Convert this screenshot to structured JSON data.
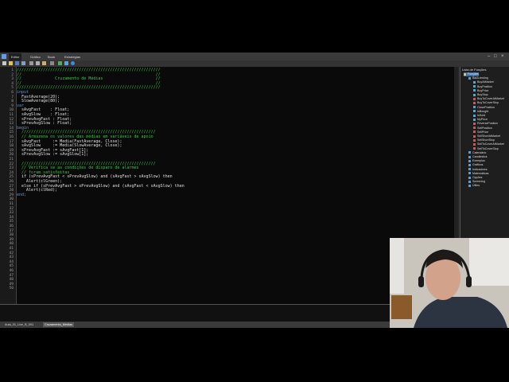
{
  "tabs": [
    {
      "label": "Editor",
      "active": true
    },
    {
      "label": "Gráfico",
      "active": false
    },
    {
      "label": "Book",
      "active": false
    },
    {
      "label": "Estratégias",
      "active": false
    }
  ],
  "window_controls": [
    "–",
    "□",
    "×"
  ],
  "gutter_numbers": [
    "1",
    "2",
    "3",
    "4",
    "5",
    "6",
    "7",
    "8",
    "9",
    "10",
    "11",
    "12",
    "13",
    "14",
    "15",
    "16",
    "17",
    "18",
    "19",
    "20",
    "21",
    "22",
    "23",
    "24",
    "25",
    "26",
    "27",
    "28",
    "29",
    "30",
    "31",
    "32",
    "33",
    "34",
    "35",
    "36",
    "37",
    "38",
    "39",
    "40",
    "41",
    "42",
    "43",
    "44",
    "45",
    "46",
    "47",
    "48",
    "49",
    "50"
  ],
  "code_lines": [
    {
      "t": "////////////////////////////////////////////////////////////",
      "c": "#2ecc40"
    },
    {
      "t": "//                                                        //",
      "c": "#2ecc40"
    },
    {
      "t": "//              Cruzamento de Médias                      //",
      "c": "#2ecc40"
    },
    {
      "t": "//                                                        //",
      "c": "#2ecc40"
    },
    {
      "t": "////////////////////////////////////////////////////////////",
      "c": "#2ecc40"
    },
    {
      "t": "input",
      "c": "#5b9bd5"
    },
    {
      "t": "  FastAverage(20);",
      "c": "#e0e0e0"
    },
    {
      "t": "  SlowAverage(80);",
      "c": "#e0e0e0"
    },
    {
      "t": "var",
      "c": "#5b9bd5"
    },
    {
      "t": "  sAvgFast    : Float;",
      "c": "#e0e0e0"
    },
    {
      "t": "  sAvgSlow    : Float;",
      "c": "#e0e0e0"
    },
    {
      "t": "  sPrevAvgFast : Float;",
      "c": "#e0e0e0"
    },
    {
      "t": "  sPrevAvgSlow : Float;",
      "c": "#e0e0e0"
    },
    {
      "t": "begin",
      "c": "#5b9bd5"
    },
    {
      "t": "  ////////////////////////////////////////////////////////",
      "c": "#2ecc40"
    },
    {
      "t": "  // Armazena os valores das médias em variáveis de apoio",
      "c": "#2ecc40"
    },
    {
      "t": "  sAvgFast     := Media(FastAverage, Close);",
      "c": "#e0e0e0"
    },
    {
      "t": "  sAvgSlow     := Media(SlowAverage, Close);",
      "c": "#e0e0e0"
    },
    {
      "t": "  sPrevAvgFast := sAvgFast[1];",
      "c": "#e0e0e0"
    },
    {
      "t": "  sPrevAvgSlow := sAvgSlow[1];",
      "c": "#e0e0e0"
    },
    {
      "t": "",
      "c": "#e0e0e0"
    },
    {
      "t": "  ////////////////////////////////////////////////////////",
      "c": "#2ecc40"
    },
    {
      "t": "  // Verifica se as condições de disparo de alarmes",
      "c": "#2ecc40"
    },
    {
      "t": "  // foram satisfeitas",
      "c": "#2ecc40"
    },
    {
      "t": "  if (sPrevAvgFast < sPrevAvgSlow) and (sAvgFast > sAvgSlow) then",
      "c": "#e0e0e0"
    },
    {
      "t": "    Alert(clGreen);",
      "c": "#e0e0e0"
    },
    {
      "t": "  else if (sPrevAvgFast > sPrevAvgSlow) and (sAvgFast < sAvgSlow) then",
      "c": "#e0e0e0"
    },
    {
      "t": "    Alert(clRed);",
      "c": "#e0e0e0"
    },
    {
      "t": "end;",
      "c": "#5b9bd5"
    }
  ],
  "documents": [
    {
      "label": "Aula_01_Live_B_001",
      "active": false
    },
    {
      "label": "Cruzamento_Medias",
      "active": true
    }
  ],
  "panel": {
    "title": "Lista de Funções",
    "items": [
      {
        "label": "Funções",
        "level": 0,
        "color": "#e8c04a",
        "sel": true
      },
      {
        "label": "Back-testing",
        "level": 1,
        "color": "#4aa3e8",
        "sel": false
      },
      {
        "label": "BuyAtMarket",
        "level": 2,
        "color": "#3cb0e8",
        "sel": false
      },
      {
        "label": "BuyPosition",
        "level": 2,
        "color": "#3cb0e8",
        "sel": false
      },
      {
        "label": "BuyPrice",
        "level": 2,
        "color": "#3cb0e8",
        "sel": false
      },
      {
        "label": "BuyStop",
        "level": 2,
        "color": "#3cb0e8",
        "sel": false
      },
      {
        "label": "BuyToCoverAtMarket",
        "level": 2,
        "color": "#e05050",
        "sel": false
      },
      {
        "label": "BuyToCoverStop",
        "level": 2,
        "color": "#e05050",
        "sel": false
      },
      {
        "label": "ClosePosition",
        "level": 2,
        "color": "#3cb0e8",
        "sel": false
      },
      {
        "label": "IsBought",
        "level": 2,
        "color": "#3cb0e8",
        "sel": false
      },
      {
        "label": "IsSold",
        "level": 2,
        "color": "#3cb0e8",
        "sel": false
      },
      {
        "label": "MyPrice",
        "level": 2,
        "color": "#3cb0e8",
        "sel": false
      },
      {
        "label": "ReversePosition",
        "level": 2,
        "color": "#e05050",
        "sel": false
      },
      {
        "label": "SellPosition",
        "level": 2,
        "color": "#e05050",
        "sel": false
      },
      {
        "label": "SellPrice",
        "level": 2,
        "color": "#e05050",
        "sel": false
      },
      {
        "label": "SellShortAtMarket",
        "level": 2,
        "color": "#e05050",
        "sel": false
      },
      {
        "label": "SellShortStop",
        "level": 2,
        "color": "#e05050",
        "sel": false
      },
      {
        "label": "SellToCoverAtMarket",
        "level": 2,
        "color": "#e05050",
        "sel": false
      },
      {
        "label": "SellToCoverStop",
        "level": 2,
        "color": "#e05050",
        "sel": false
      },
      {
        "label": "Calendário",
        "level": 1,
        "color": "#4aa3e8",
        "sel": false
      },
      {
        "label": "Candlestick",
        "level": 1,
        "color": "#4aa3e8",
        "sel": false
      },
      {
        "label": "Exemplos",
        "level": 1,
        "color": "#4aa3e8",
        "sel": false
      },
      {
        "label": "Gráficos",
        "level": 1,
        "color": "#4aa3e8",
        "sel": false
      },
      {
        "label": "Indicadores",
        "level": 1,
        "color": "#4aa3e8",
        "sel": false
      },
      {
        "label": "Matemáticas",
        "level": 1,
        "color": "#4aa3e8",
        "sel": false
      },
      {
        "label": "Opções",
        "level": 1,
        "color": "#4aa3e8",
        "sel": false
      },
      {
        "label": "Screening",
        "level": 1,
        "color": "#4aa3e8",
        "sel": false
      },
      {
        "label": "Útiles",
        "level": 1,
        "color": "#4aa3e8",
        "sel": false
      }
    ]
  },
  "colors": {
    "accent": "#5fa0e8",
    "comment": "#2ecc40",
    "keyword": "#5b9bd5",
    "text": "#e0e0e0",
    "editor_bg": "#0a0a0a"
  }
}
